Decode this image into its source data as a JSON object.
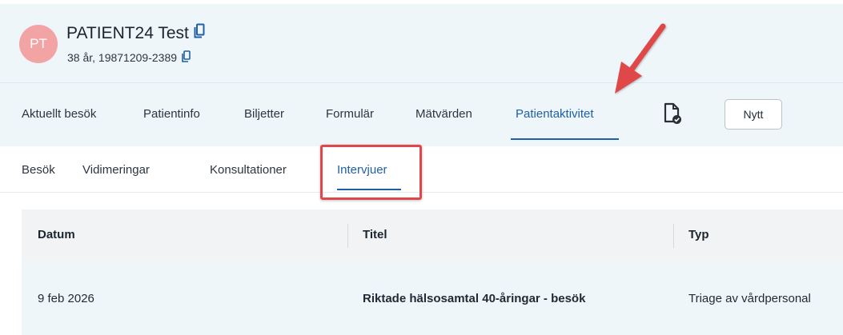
{
  "patient": {
    "initials": "PT",
    "name": "PATIENT24 Test",
    "age_id": "38 år, 19871209-2389",
    "avatar_color": "#f2a3a3"
  },
  "main_tabs": [
    {
      "label": "Aktuellt besök",
      "active": false
    },
    {
      "label": "Patientinfo",
      "active": false
    },
    {
      "label": "Biljetter",
      "active": false
    },
    {
      "label": "Formulär",
      "active": false
    },
    {
      "label": "Mätvärden",
      "active": false
    },
    {
      "label": "Patientaktivitet",
      "active": true
    }
  ],
  "toolbar": {
    "document_icon": "document-check-icon",
    "new_label": "Nytt"
  },
  "sub_tabs": [
    {
      "label": "Besök",
      "active": false
    },
    {
      "label": "Vidimeringar",
      "active": false
    },
    {
      "label": "Konsultationer",
      "active": false
    },
    {
      "label": "Intervjuer",
      "active": true
    }
  ],
  "table": {
    "columns": [
      "Datum",
      "Titel",
      "Typ"
    ],
    "rows": [
      {
        "datum": "9 feb 2026",
        "titel": "Riktade hälsosamtal 40-åringar - besök",
        "typ": "Triage av vårdpersonal"
      }
    ]
  },
  "colors": {
    "accent": "#1f5fa8",
    "annotation": "#e0464a",
    "header_bg": "#eef6f9"
  }
}
